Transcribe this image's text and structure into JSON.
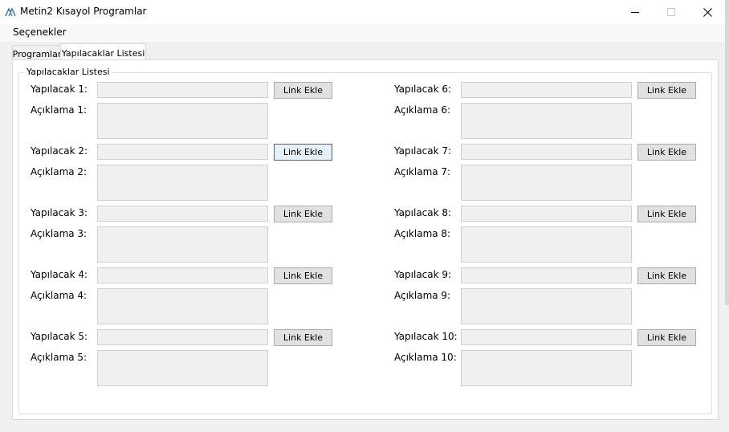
{
  "window": {
    "title": "Metin2 Kısayol Programlar"
  },
  "menu": {
    "items": [
      "Seçenekler"
    ]
  },
  "tabs": [
    {
      "label": "Programlar",
      "active": false
    },
    {
      "label": "Yapılacaklar Listesi",
      "active": true
    }
  ],
  "group": {
    "title": "Yapılacaklar Listesi"
  },
  "link_button_label": "Link Ekle",
  "left_items": [
    {
      "todo_label": "Yapılacak 1:",
      "desc_label": "Açıklama 1:",
      "todo_value": "",
      "desc_value": ""
    },
    {
      "todo_label": "Yapılacak 2:",
      "desc_label": "Açıklama 2:",
      "todo_value": "",
      "desc_value": ""
    },
    {
      "todo_label": "Yapılacak 3:",
      "desc_label": "Açıklama 3:",
      "todo_value": "",
      "desc_value": ""
    },
    {
      "todo_label": "Yapılacak 4:",
      "desc_label": "Açıklama 4:",
      "todo_value": "",
      "desc_value": ""
    },
    {
      "todo_label": "Yapılacak 5:",
      "desc_label": "Açıklama 5:",
      "todo_value": "",
      "desc_value": ""
    }
  ],
  "right_items": [
    {
      "todo_label": "Yapılacak 6:",
      "desc_label": "Açıklama 6:",
      "todo_value": "",
      "desc_value": ""
    },
    {
      "todo_label": "Yapılacak 7:",
      "desc_label": "Açıklama 7:",
      "todo_value": "",
      "desc_value": ""
    },
    {
      "todo_label": "Yapılacak 8:",
      "desc_label": "Açıklama 8:",
      "todo_value": "",
      "desc_value": ""
    },
    {
      "todo_label": "Yapılacak 9:",
      "desc_label": "Açıklama 9:",
      "todo_value": "",
      "desc_value": ""
    },
    {
      "todo_label": "Yapılacak 10:",
      "desc_label": "Açıklama 10:",
      "todo_value": "",
      "desc_value": ""
    }
  ],
  "focused_button": "left-2",
  "icons": {
    "app": "app-icon",
    "minimize": "minimize-icon",
    "maximize": "maximize-icon",
    "close": "close-icon"
  },
  "colors": {
    "focus_border": "#0078d7",
    "focus_fill": "#e5f1fb"
  }
}
